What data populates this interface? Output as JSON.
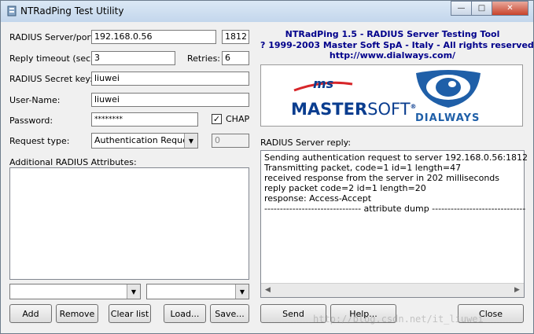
{
  "window": {
    "title": "NTRadPing Test Utility",
    "minimize_glyph": "—",
    "maximize_glyph": "□",
    "close_glyph": "✕"
  },
  "form": {
    "server_label": "RADIUS Server/port:",
    "server_value": "192.168.0.56",
    "port_value": "1812",
    "timeout_label": "Reply timeout (sec.):",
    "timeout_value": "3",
    "retries_label": "Retries:",
    "retries_value": "6",
    "secret_label": "RADIUS Secret key:",
    "secret_value": "liuwei",
    "username_label": "User-Name:",
    "username_value": "liuwei",
    "password_label": "Password:",
    "password_value": "********",
    "chap_label": "CHAP",
    "chap_checked": true,
    "request_label": "Request type:",
    "request_value": "Authentication Request",
    "request_extra_value": "0",
    "attributes_label": "Additional RADIUS Attributes:"
  },
  "about": {
    "line1": "NTRadPing 1.5 - RADIUS Server Testing Tool",
    "line2": "? 1999-2003 Master Soft SpA - Italy - All rights reserved",
    "line3": "http://www.dialways.com/"
  },
  "logos": {
    "ms_badge": "ms",
    "master": "MASTER",
    "soft": "SOFT",
    "registered": "®",
    "dialways": "DIALWAYS",
    "colors": {
      "mastersoft_blue": "#0a3d8f",
      "ms_red": "#d7262a",
      "dialways_blue": "#1f5fa8"
    }
  },
  "reply": {
    "label": "RADIUS Server reply:",
    "lines": [
      "Sending authentication request to server 192.168.0.56:1812",
      "Transmitting packet, code=1 id=1 length=47",
      "received response from the server in 202 milliseconds",
      "reply packet code=2 id=1 length=20",
      "response: Access-Accept",
      "------------------------------- attribute dump ------------------------------"
    ]
  },
  "buttons": {
    "add": "Add",
    "remove": "Remove",
    "clear": "Clear list",
    "load": "Load...",
    "save": "Save...",
    "send": "Send",
    "help": "Help...",
    "close": "Close"
  },
  "watermark": "http://blog.csdn.net/it_liuwei"
}
